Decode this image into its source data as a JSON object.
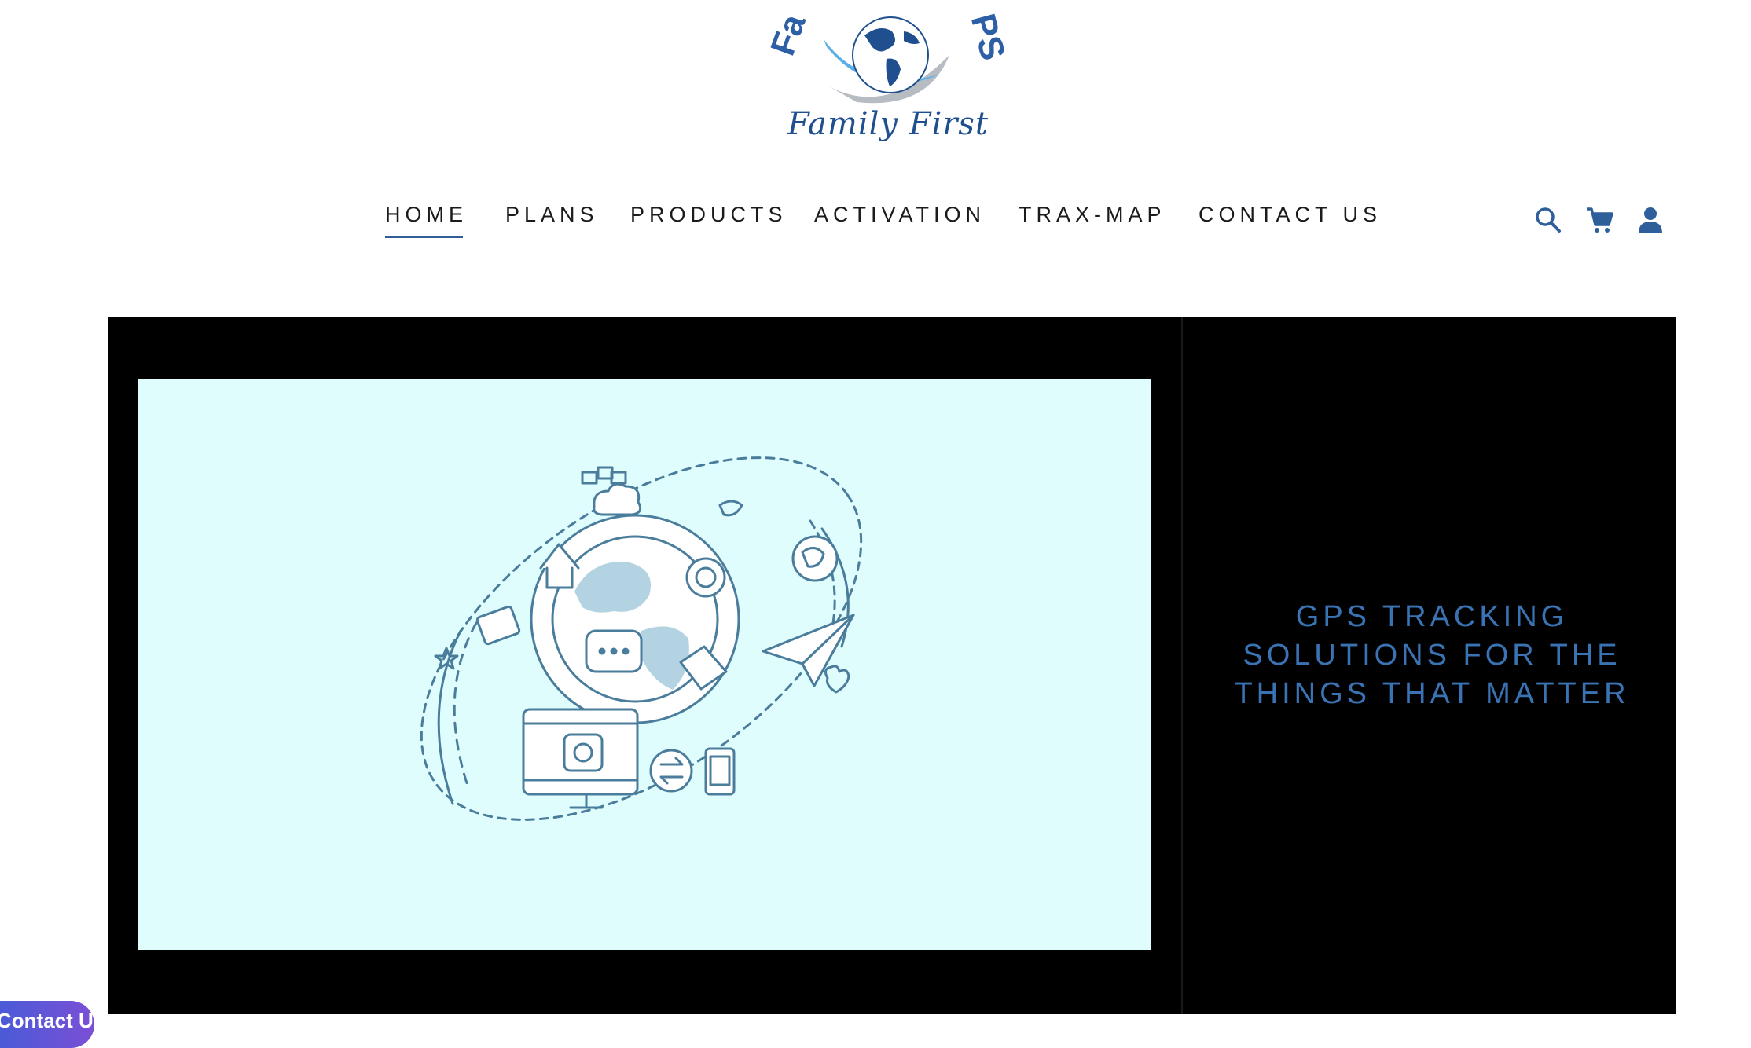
{
  "logo": {
    "arc_text_left": "Fa",
    "arc_text_right": "PS",
    "tagline": "Family First"
  },
  "nav": {
    "items": [
      {
        "label": "HOME",
        "active": true
      },
      {
        "label": "PLANS",
        "active": false
      },
      {
        "label": "PRODUCTS",
        "active": false
      },
      {
        "label": "ACTIVATION",
        "active": false
      },
      {
        "label": "TRAX-MAP",
        "active": false
      },
      {
        "label": "CONTACT US",
        "active": false
      }
    ],
    "icons": [
      "search-icon",
      "cart-icon",
      "account-icon"
    ]
  },
  "hero": {
    "headline": "GPS TRACKING SOLUTIONS FOR THE THINGS THAT MATTER",
    "media_background": "#e0fdfe"
  },
  "contact_badge": {
    "label": "Contact Us"
  },
  "colors": {
    "brand_blue": "#3a73b4",
    "nav_text": "#1b1b1b",
    "hero_bg": "#000000",
    "badge_gradient_start": "#3a5fd8",
    "badge_gradient_end": "#7b4fd6"
  }
}
